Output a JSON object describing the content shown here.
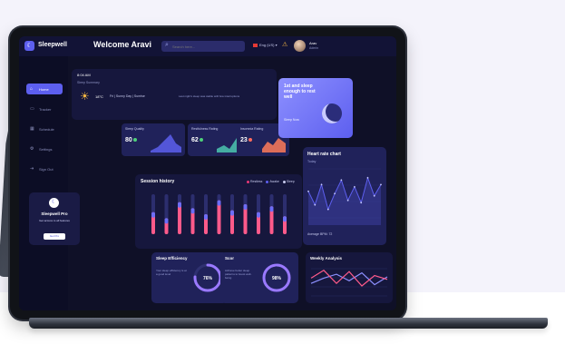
{
  "app": {
    "name": "Sleepwell",
    "welcome": "Welcome Aravi",
    "search_placeholder": "Search here...",
    "language": "Eng (US)",
    "user_name": "Arav",
    "user_role": "Admin"
  },
  "sidebar": {
    "items": [
      {
        "label": "Home",
        "icon": "home-icon"
      },
      {
        "label": "Tracker",
        "icon": "tracker-icon"
      },
      {
        "label": "Schedule",
        "icon": "calendar-icon"
      },
      {
        "label": "Settings",
        "icon": "gear-icon"
      },
      {
        "label": "Sign Out",
        "icon": "logout-icon"
      }
    ],
    "promo": {
      "title": "Sleepwell Pro",
      "subtitle": "Get access to all features",
      "button": "Get Pro"
    }
  },
  "summary": {
    "time": "8:04 AM",
    "label": "Sleep Summary",
    "temp": "18°C",
    "weather_desc": "Fri | Sunny Day | Sunrise",
    "weather_msg": "Last night's sleep was stable with few interruptions"
  },
  "mini_cards": [
    {
      "label": "Sleep Quality",
      "value": "80",
      "color": "#4ed17a"
    },
    {
      "label": "Restfulness Rating",
      "value": "62",
      "color": "#4ed17a"
    },
    {
      "label": "Insomnia Rating",
      "value": "23",
      "color": "#ff6b5e"
    }
  ],
  "hero": {
    "title": "1st and sleep enough to rest well",
    "cta": "Sleep Now"
  },
  "session": {
    "title": "Session history",
    "legend": [
      "Restless",
      "Awake",
      "Sleep"
    ],
    "legend_colors": [
      "#e53977",
      "#5d5fef",
      "#c8cbee"
    ],
    "levels": [
      0.55,
      0.4,
      0.8,
      0.65,
      0.5,
      0.85,
      0.6,
      0.75,
      0.55,
      0.7,
      0.45
    ],
    "level_colors": [
      "#ff5a8a",
      "#6c6ef7"
    ]
  },
  "heart": {
    "title": "Heart rate chart",
    "period": "Today",
    "footer": "Average BPM: 72",
    "points": [
      60,
      48,
      66,
      44,
      58,
      70,
      52,
      64,
      50,
      72,
      56,
      66
    ],
    "point_color": "#5d5fef"
  },
  "efficiency": {
    "title": "Sleep Efficiency",
    "desc": "Your sleep efficiency is at a good level",
    "value_label": "76%",
    "value": 0.76,
    "color": "#9a79ff"
  },
  "score": {
    "title": "Scor",
    "desc": "Achieve better sleep patterns to boost well-being",
    "value_label": "98%",
    "value": 0.98,
    "color": "#9a79ff"
  },
  "weekly": {
    "title": "Weekly Analysis",
    "series_a": [
      30,
      42,
      22,
      40,
      18,
      34,
      28
    ],
    "series_b": [
      22,
      30,
      36,
      26,
      38,
      20,
      32
    ],
    "color_a": "#ff5a8a",
    "color_b": "#8d90ff"
  }
}
